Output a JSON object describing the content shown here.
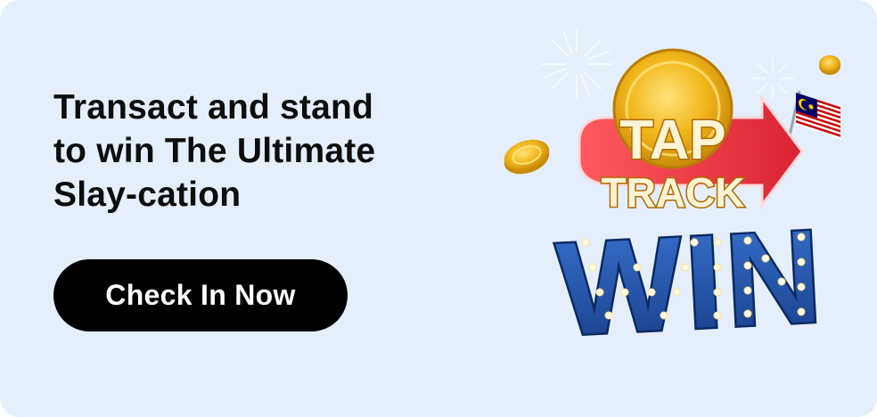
{
  "banner": {
    "headline_lines": [
      "Transact and stand",
      "to win The Ultimate",
      "Slay-cation"
    ],
    "cta_label": "Check In Now"
  },
  "campaign_logo": {
    "line1": "TAP",
    "line2": "TRACK",
    "line3": "WIN"
  },
  "colors": {
    "card_background": "#e4effb",
    "button_background": "#000000",
    "button_text": "#ffffff",
    "headline_text": "#0d0d0d",
    "gold": "#f2b71c",
    "arrow_red": "#e8333b",
    "win_blue": "#1f4c9e"
  },
  "icons": [
    "coin-icon",
    "flag-malaysia-icon",
    "firework-icon",
    "arrow-icon"
  ]
}
